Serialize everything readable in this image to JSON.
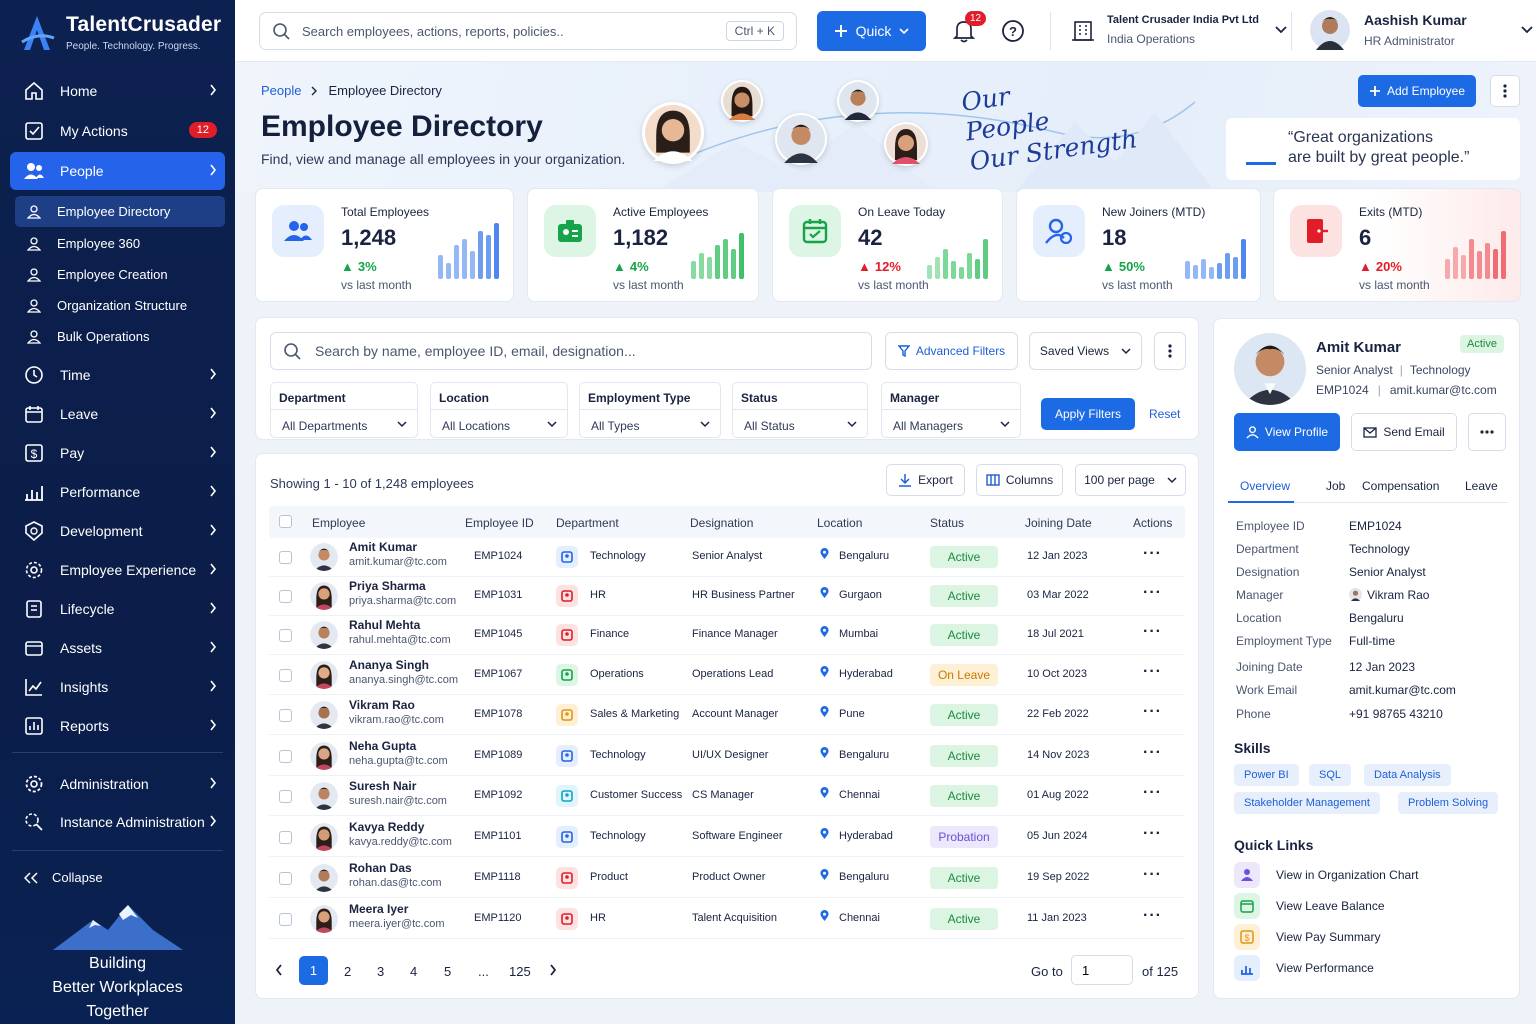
{
  "app": {
    "name": "TalentCrusader",
    "tagline": "People. Technology. Progress."
  },
  "sidebar": {
    "items": [
      {
        "label": "Home"
      },
      {
        "label": "My Actions",
        "badge": "12"
      },
      {
        "label": "People"
      },
      {
        "label": "Time"
      },
      {
        "label": "Leave"
      },
      {
        "label": "Pay"
      },
      {
        "label": "Performance"
      },
      {
        "label": "Development"
      },
      {
        "label": "Employee Experience"
      },
      {
        "label": "Lifecycle"
      },
      {
        "label": "Assets"
      },
      {
        "label": "Insights"
      },
      {
        "label": "Reports"
      },
      {
        "label": "Administration"
      },
      {
        "label": "Instance Administration"
      }
    ],
    "people_sub": [
      {
        "label": "Employee Directory"
      },
      {
        "label": "Employee 360"
      },
      {
        "label": "Employee Creation"
      },
      {
        "label": "Organization Structure"
      },
      {
        "label": "Bulk Operations"
      }
    ],
    "collapse": "Collapse",
    "promo": [
      "Building",
      "Better Workplaces",
      "Together"
    ]
  },
  "topbar": {
    "search_placeholder": "Search employees, actions, reports, policies..",
    "shortcut": "Ctrl + K",
    "quick": "Quick",
    "notifications": "12",
    "org_name": "Talent Crusader India Pvt Ltd",
    "org_unit": "India Operations",
    "user_name": "Aashish Kumar",
    "user_role": "HR Administrator"
  },
  "hero": {
    "breadcrumb": [
      "People",
      "Employee Directory"
    ],
    "title": "Employee Directory",
    "subtitle": "Find, view and manage all employees in your organization.",
    "slogan": [
      "Our",
      "People",
      "Our Strength"
    ],
    "add_button": "Add Employee",
    "quote": [
      "“Great organizations",
      "are built by great people.”"
    ]
  },
  "kpis": [
    {
      "label": "Total Employees",
      "value": "1,248",
      "change": "3%",
      "direction": "up",
      "vs": "vs last month",
      "color": "#2563eb"
    },
    {
      "label": "Active Employees",
      "value": "1,182",
      "change": "4%",
      "direction": "up",
      "vs": "vs last month",
      "color": "#16a34a"
    },
    {
      "label": "On Leave Today",
      "value": "42",
      "change": "12%",
      "direction": "up",
      "vs": "vs last month",
      "color": "#16a34a"
    },
    {
      "label": "New Joiners (MTD)",
      "value": "18",
      "change": "50%",
      "direction": "up",
      "vs": "vs last month",
      "color": "#2563eb"
    },
    {
      "label": "Exits (MTD)",
      "value": "6",
      "change": "20%",
      "direction": "up",
      "vs": "vs last month",
      "color": "#e11d2a"
    }
  ],
  "filters": {
    "search_placeholder": "Search by name, employee ID, email, designation...",
    "advanced": "Advanced Filters",
    "saved_views": "Saved Views",
    "selects": [
      {
        "label": "Department",
        "value": "All Departments"
      },
      {
        "label": "Location",
        "value": "All Locations"
      },
      {
        "label": "Employment Type",
        "value": "All Types"
      },
      {
        "label": "Status",
        "value": "All Status"
      },
      {
        "label": "Manager",
        "value": "All Managers"
      }
    ],
    "apply": "Apply Filters",
    "reset": "Reset"
  },
  "table": {
    "showing": "Showing 1 - 10 of 1,248 employees",
    "export": "Export",
    "columns_btn": "Columns",
    "per_page": "100 per page",
    "headers": [
      "Employee",
      "Employee ID",
      "Department",
      "Designation",
      "Location",
      "Status",
      "Joining Date",
      "Actions"
    ],
    "rows": [
      {
        "name": "Amit Kumar",
        "email": "amit.kumar@tc.com",
        "id": "EMP1024",
        "dept": "Technology",
        "desig": "Senior Analyst",
        "loc": "Bengaluru",
        "status": "Active",
        "date": "12 Jan 2023"
      },
      {
        "name": "Priya Sharma",
        "email": "priya.sharma@tc.com",
        "id": "EMP1031",
        "dept": "HR",
        "desig": "HR Business Partner",
        "loc": "Gurgaon",
        "status": "Active",
        "date": "03 Mar 2022"
      },
      {
        "name": "Rahul Mehta",
        "email": "rahul.mehta@tc.com",
        "id": "EMP1045",
        "dept": "Finance",
        "desig": "Finance Manager",
        "loc": "Mumbai",
        "status": "Active",
        "date": "18 Jul 2021"
      },
      {
        "name": "Ananya Singh",
        "email": "ananya.singh@tc.com",
        "id": "EMP1067",
        "dept": "Operations",
        "desig": "Operations Lead",
        "loc": "Hyderabad",
        "status": "On Leave",
        "date": "10 Oct 2023"
      },
      {
        "name": "Vikram Rao",
        "email": "vikram.rao@tc.com",
        "id": "EMP1078",
        "dept": "Sales & Marketing",
        "desig": "Account Manager",
        "loc": "Pune",
        "status": "Active",
        "date": "22 Feb 2022"
      },
      {
        "name": "Neha Gupta",
        "email": "neha.gupta@tc.com",
        "id": "EMP1089",
        "dept": "Technology",
        "desig": "UI/UX Designer",
        "loc": "Bengaluru",
        "status": "Active",
        "date": "14 Nov 2023"
      },
      {
        "name": "Suresh Nair",
        "email": "suresh.nair@tc.com",
        "id": "EMP1092",
        "dept": "Customer Success",
        "desig": "CS Manager",
        "loc": "Chennai",
        "status": "Active",
        "date": "01 Aug 2022"
      },
      {
        "name": "Kavya Reddy",
        "email": "kavya.reddy@tc.com",
        "id": "EMP1101",
        "dept": "Technology",
        "desig": "Software Engineer",
        "loc": "Hyderabad",
        "status": "Probation",
        "date": "05 Jun 2024"
      },
      {
        "name": "Rohan Das",
        "email": "rohan.das@tc.com",
        "id": "EMP1118",
        "dept": "Product",
        "desig": "Product Owner",
        "loc": "Bengaluru",
        "status": "Active",
        "date": "19 Sep 2022"
      },
      {
        "name": "Meera Iyer",
        "email": "meera.iyer@tc.com",
        "id": "EMP1120",
        "dept": "HR",
        "desig": "Talent Acquisition",
        "loc": "Chennai",
        "status": "Active",
        "date": "11 Jan 2023"
      }
    ],
    "pages": [
      "1",
      "2",
      "3",
      "4",
      "5",
      "...",
      "125"
    ],
    "goto_label": "Go to",
    "goto_value": "1",
    "of_label": "of 125"
  },
  "profile": {
    "name": "Amit Kumar",
    "status": "Active",
    "title": "Senior Analyst",
    "dept": "Technology",
    "id": "EMP1024",
    "email": "amit.kumar@tc.com",
    "view_profile": "View Profile",
    "send_email": "Send Email",
    "tabs": [
      "Overview",
      "Job",
      "Compensation",
      "Leave"
    ],
    "fields": [
      {
        "k": "Employee ID",
        "v": "EMP1024"
      },
      {
        "k": "Department",
        "v": "Technology"
      },
      {
        "k": "Designation",
        "v": "Senior Analyst"
      },
      {
        "k": "Manager",
        "v": "Vikram Rao"
      },
      {
        "k": "Location",
        "v": "Bengaluru"
      },
      {
        "k": "Employment Type",
        "v": "Full-time"
      },
      {
        "k": "Joining Date",
        "v": "12 Jan 2023"
      },
      {
        "k": "Work Email",
        "v": "amit.kumar@tc.com"
      },
      {
        "k": "Phone",
        "v": "+91 98765 43210"
      }
    ],
    "skills_title": "Skills",
    "skills": [
      "Power BI",
      "SQL",
      "Data Analysis",
      "Stakeholder Management",
      "Problem Solving"
    ],
    "quick_title": "Quick Links",
    "quick_links": [
      "View in Organization Chart",
      "View Leave Balance",
      "View Pay Summary",
      "View Performance"
    ]
  }
}
